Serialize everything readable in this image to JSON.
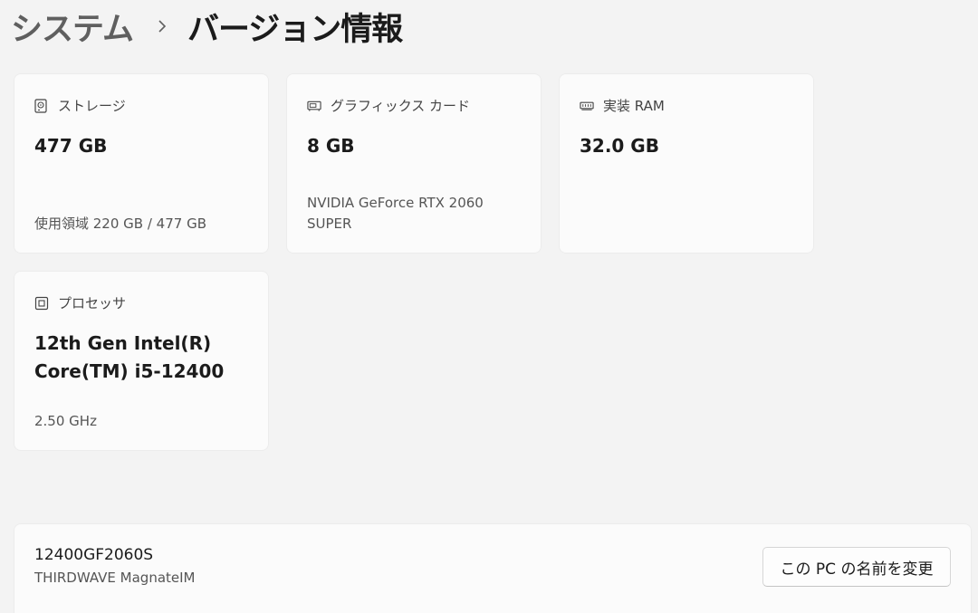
{
  "breadcrumb": {
    "parent": "システム",
    "separator_icon": "chevron-right-icon",
    "current": "バージョン情報"
  },
  "cards": {
    "storage": {
      "icon": "hard-drive-icon",
      "label": "ストレージ",
      "value": "477 GB",
      "sub": "使用領域 220 GB / 477 GB"
    },
    "gpu": {
      "icon": "graphics-card-icon",
      "label": "グラフィックス カード",
      "value": "8 GB",
      "sub_line1": "NVIDIA GeForce RTX 2060",
      "sub_line2": "SUPER"
    },
    "ram": {
      "icon": "memory-icon",
      "label": "実装 RAM",
      "value": "32.0 GB"
    },
    "cpu": {
      "icon": "processor-icon",
      "label": "プロセッサ",
      "value_line1": "12th Gen Intel(R)",
      "value_line2": "Core(TM) i5-12400",
      "sub": "2.50 GHz"
    }
  },
  "device": {
    "name": "12400GF2060S",
    "model": "THIRDWAVE MagnateIM",
    "rename_label": "この PC の名前を変更"
  },
  "colors": {
    "background": "#f3f3f3",
    "card": "#fbfbfb",
    "text": "#1b1b1b"
  }
}
